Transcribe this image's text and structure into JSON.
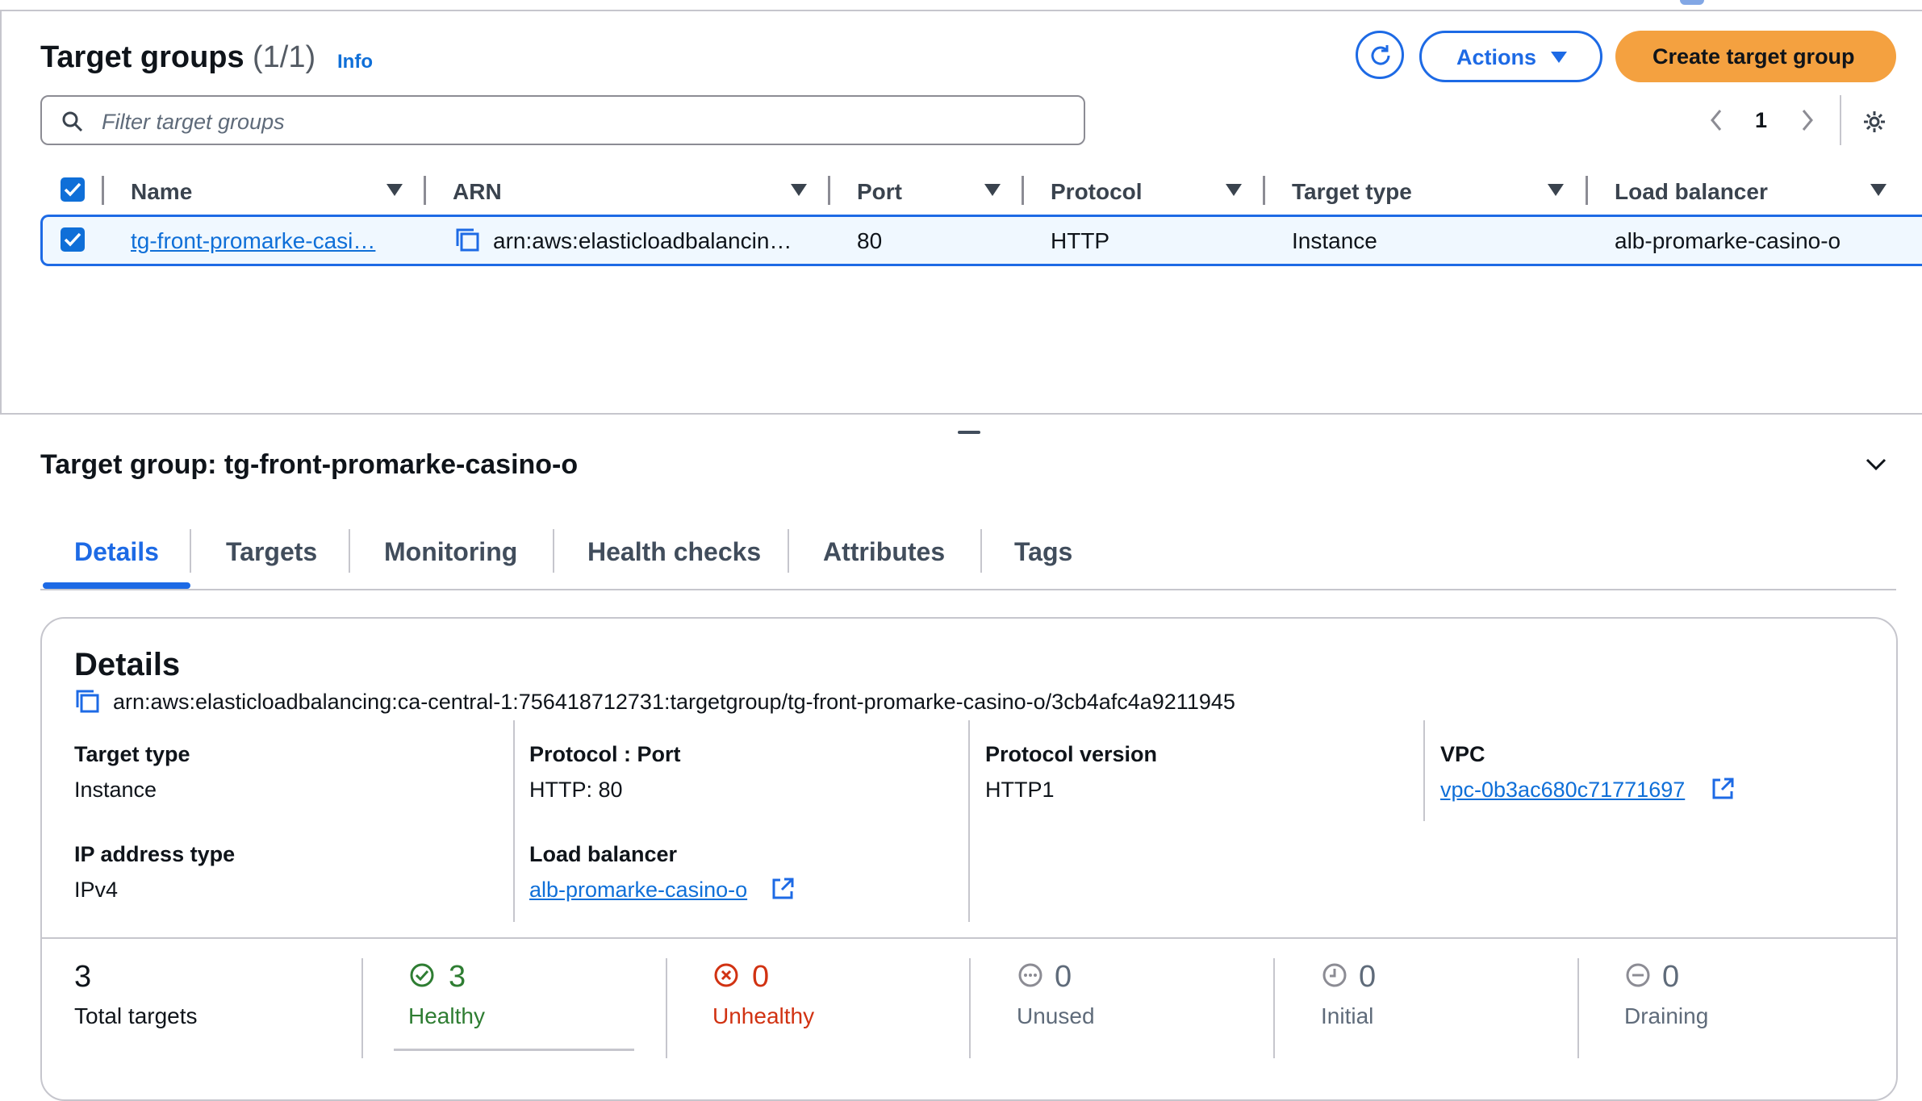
{
  "header": {
    "title": "Target groups",
    "count": "(1/1)",
    "info_link": "Info",
    "actions_label": "Actions",
    "create_label": "Create target group"
  },
  "search": {
    "placeholder": "Filter target groups"
  },
  "pagination": {
    "current_page": "1"
  },
  "table": {
    "columns": [
      "Name",
      "ARN",
      "Port",
      "Protocol",
      "Target type",
      "Load balancer"
    ],
    "rows": [
      {
        "name": "tg-front-promarke-casi…",
        "arn": "arn:aws:elasticloadbalancin…",
        "port": "80",
        "protocol": "HTTP",
        "target_type": "Instance",
        "load_balancer": "alb-promarke-casino-o",
        "selected": true
      }
    ]
  },
  "detail": {
    "title": "Target group: tg-front-promarke-casino-o",
    "tabs": [
      "Details",
      "Targets",
      "Monitoring",
      "Health checks",
      "Attributes",
      "Tags"
    ],
    "active_tab": "Details",
    "card_title": "Details",
    "arn_full": "arn:aws:elasticloadbalancing:ca-central-1:756418712731:targetgroup/tg-front-promarke-casino-o/3cb4afc4a9211945",
    "fields": {
      "target_type_label": "Target type",
      "target_type_value": "Instance",
      "protocol_port_label": "Protocol : Port",
      "protocol_port_value": "HTTP: 80",
      "protocol_version_label": "Protocol version",
      "protocol_version_value": "HTTP1",
      "vpc_label": "VPC",
      "vpc_value": "vpc-0b3ac680c71771697",
      "ip_type_label": "IP address type",
      "ip_type_value": "IPv4",
      "lb_label": "Load balancer",
      "lb_value": "alb-promarke-casino-o"
    },
    "stats": [
      {
        "value": "3",
        "label": "Total targets"
      },
      {
        "value": "3",
        "label": "Healthy"
      },
      {
        "value": "0",
        "label": "Unhealthy"
      },
      {
        "value": "0",
        "label": "Unused"
      },
      {
        "value": "0",
        "label": "Initial"
      },
      {
        "value": "0",
        "label": "Draining"
      }
    ]
  },
  "colors": {
    "accent": "#1d6ae5",
    "primary_button": "#f4a140",
    "healthy": "#2e7d32",
    "unhealthy": "#d13212",
    "muted": "#5f6b7a"
  }
}
